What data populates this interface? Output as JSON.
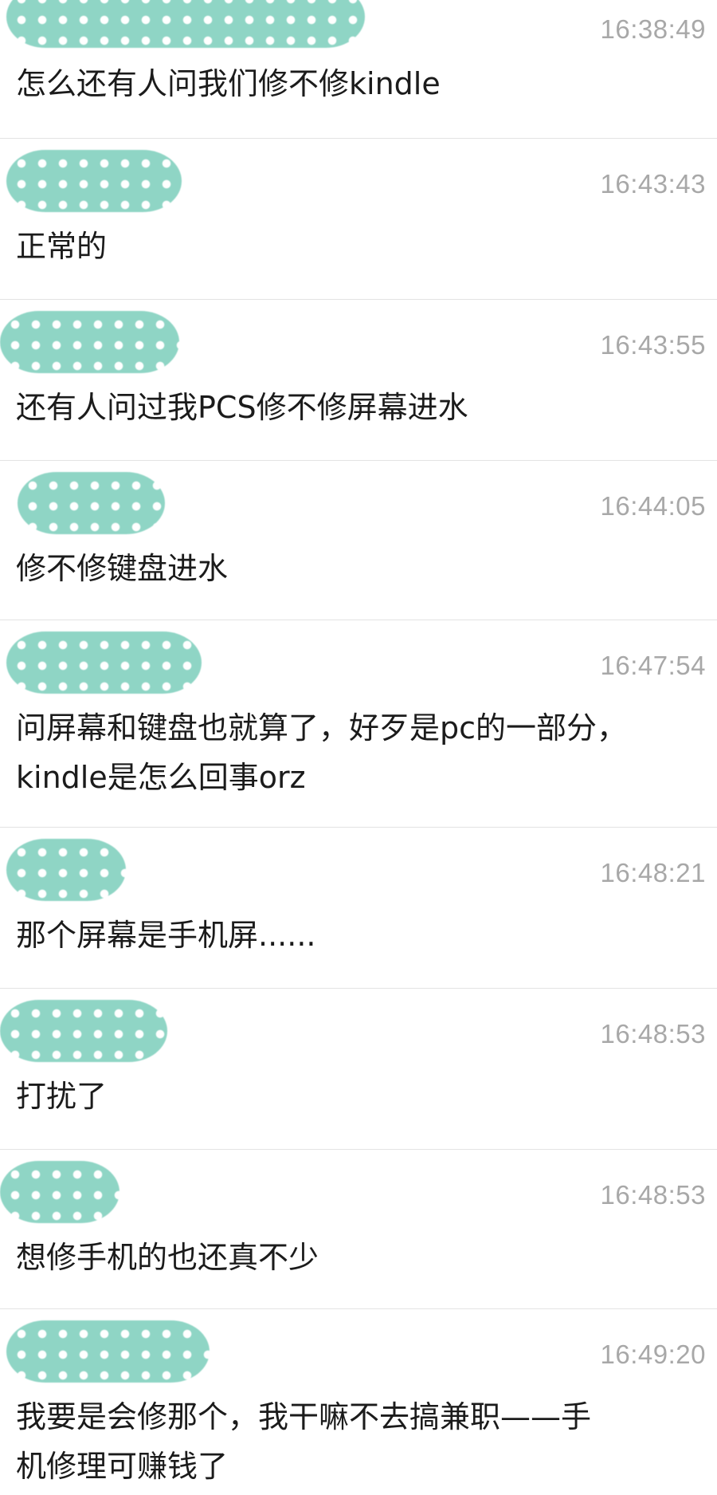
{
  "messages": [
    {
      "time": "16:38:49",
      "text": "怎么还有人问我们修不修kindle"
    },
    {
      "time": "16:43:43",
      "text": "正常的"
    },
    {
      "time": "16:43:55",
      "text": "还有人问过我PCS修不修屏幕进水"
    },
    {
      "time": "16:44:05",
      "text": "修不修键盘进水"
    },
    {
      "time": "16:47:54",
      "text": "问屏幕和键盘也就算了，好歹是pc的一部分，\nkindle是怎么回事orz"
    },
    {
      "time": "16:48:21",
      "text": "那个屏幕是手机屏......"
    },
    {
      "time": "16:48:53",
      "text": "打扰了"
    },
    {
      "time": "16:48:53",
      "text": "想修手机的也还真不少"
    },
    {
      "time": "16:49:20",
      "text": "我要是会修那个，我干嘛不去搞兼职——手\n机修理可赚钱了"
    }
  ]
}
